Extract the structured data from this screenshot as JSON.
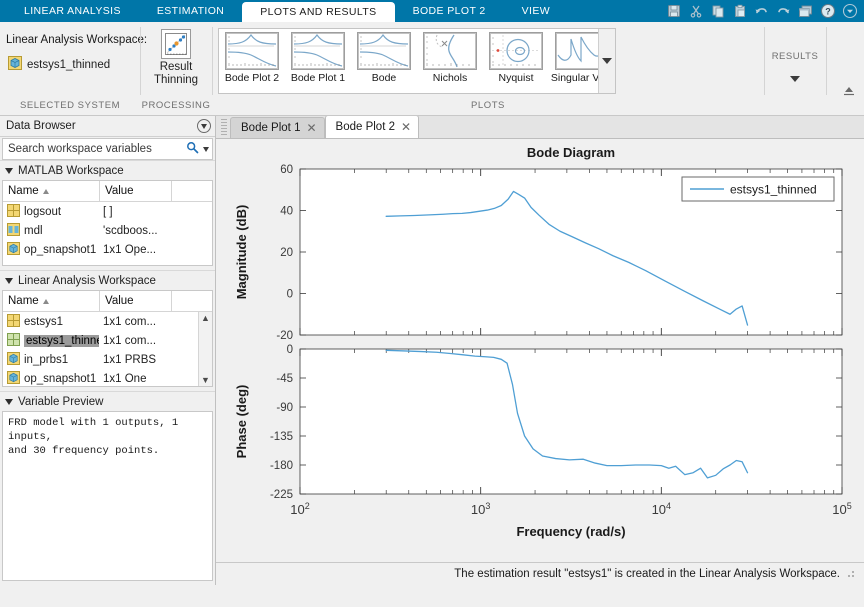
{
  "ribbon": {
    "tabs": [
      {
        "label": "LINEAR ANALYSIS",
        "active": false
      },
      {
        "label": "ESTIMATION",
        "active": false
      },
      {
        "label": "PLOTS AND RESULTS",
        "active": true
      },
      {
        "label": "BODE PLOT 2",
        "active": false
      },
      {
        "label": "VIEW",
        "active": false
      }
    ],
    "quick_access": [
      "save-icon",
      "cut-icon",
      "copy-icon",
      "paste-icon",
      "undo-icon",
      "redo-icon",
      "layout-icon",
      "help-icon",
      "options-icon"
    ],
    "groups": {
      "selected_system": {
        "label": "SELECTED SYSTEM",
        "title": "Linear Analysis Workspace:",
        "variable": "estsys1_thinned"
      },
      "processing": {
        "label": "PROCESSING",
        "button_line1": "Result",
        "button_line2": "Thinning"
      },
      "plots": {
        "label": "PLOTS",
        "items": [
          {
            "label": "Bode Plot 2",
            "icon": "bode-thumbnail"
          },
          {
            "label": "Bode Plot 1",
            "icon": "bode-thumbnail"
          },
          {
            "label": "Bode",
            "icon": "bode-thumbnail"
          },
          {
            "label": "Nichols",
            "icon": "nichols-thumbnail"
          },
          {
            "label": "Nyquist",
            "icon": "nyquist-thumbnail"
          },
          {
            "label": "Singular Va...",
            "icon": "singular-values-thumbnail"
          }
        ]
      },
      "results": {
        "label": "RESULTS"
      }
    }
  },
  "browser": {
    "title": "Data Browser",
    "search": {
      "value": "",
      "placeholder": "Search workspace variables"
    },
    "matlab_workspace": {
      "title": "MATLAB Workspace",
      "columns": [
        "Name",
        "Value"
      ],
      "rows": [
        {
          "icon": "grid-variable-icon",
          "name": "logsout",
          "value": "[ ]",
          "selected": false
        },
        {
          "icon": "string-variable-icon",
          "name": "mdl",
          "value": "'scdboos...",
          "selected": false
        },
        {
          "icon": "object-variable-icon",
          "name": "op_snapshot1",
          "value": "1x1 Ope...",
          "selected": false
        }
      ]
    },
    "linear_analysis_workspace": {
      "title": "Linear Analysis Workspace",
      "columns": [
        "Name",
        "Value"
      ],
      "rows": [
        {
          "icon": "grid-variable-icon",
          "name": "estsys1",
          "value": "1x1 com...",
          "selected": false
        },
        {
          "icon": "grid-variable-icon",
          "name": "estsys1_thinned",
          "value": "1x1 com...",
          "selected": true
        },
        {
          "icon": "object-variable-icon",
          "name": "in_prbs1",
          "value": "1x1 PRBS",
          "selected": false
        },
        {
          "icon": "object-variable-icon",
          "name": "op_snapshot1",
          "value": "1x1 One",
          "selected": false
        }
      ]
    },
    "variable_preview": {
      "title": "Variable Preview",
      "line1": "FRD model with 1 outputs, 1 inputs,",
      "line2": "and 30 frequency points."
    }
  },
  "document": {
    "tabs": [
      {
        "label": "Bode Plot 1",
        "active": false,
        "closable": true
      },
      {
        "label": "Bode Plot 2",
        "active": true,
        "closable": true
      }
    ]
  },
  "status": {
    "message": "The estimation result \"estsys1\" is created in the Linear Analysis Workspace."
  },
  "colors": {
    "ribbon_blue": "#0076a8",
    "line": "#4f9fd4",
    "panel": "#f0f0f0",
    "selection_gray": "#9b9b9b"
  },
  "chart_data": {
    "type": "line",
    "title": "Bode Diagram",
    "xlabel": "Frequency  (rad/s)",
    "xscale": "log",
    "xlim": [
      100,
      100000
    ],
    "xticks": [
      100,
      1000,
      10000,
      100000
    ],
    "xticklabels": [
      "10^2",
      "10^3",
      "10^4",
      "10^5"
    ],
    "legend": [
      "estsys1_thinned"
    ],
    "legend_position": "top-right",
    "grid": false,
    "subplots": [
      {
        "name": "magnitude",
        "ylabel": "Magnitude (dB)",
        "ylim": [
          -20,
          60
        ],
        "yticks": [
          -20,
          0,
          20,
          40,
          60
        ],
        "series": [
          {
            "name": "estsys1_thinned",
            "x": [
              300,
              360,
              430,
              520,
              620,
              700,
              790,
              880,
              980,
              1090,
              1190,
              1300,
              1420,
              1520,
              1620,
              1750,
              1900,
              2100,
              2400,
              2750,
              3200,
              3800,
              4500,
              5400,
              6600,
              8200,
              10500,
              13500,
              17000,
              21000,
              24000,
              26000,
              28000,
              30000
            ],
            "y": [
              37.2,
              37.4,
              37.6,
              37.9,
              38.2,
              38.5,
              38.6,
              39.0,
              39.6,
              40.2,
              41.0,
              42.4,
              45.5,
              49.2,
              47.8,
              46.0,
              41.5,
              37.8,
              33.2,
              30.0,
              27.4,
              24.4,
              21.6,
              18.2,
              15.0,
              11.0,
              6.0,
              1.0,
              -3.5,
              -7.5,
              -10.0,
              -7.5,
              -6.0,
              -15.2
            ]
          }
        ]
      },
      {
        "name": "phase",
        "ylabel": "Phase (deg)",
        "ylim": [
          -225,
          0
        ],
        "yticks": [
          -225,
          -180,
          -135,
          -90,
          -45,
          0
        ],
        "series": [
          {
            "name": "estsys1_thinned",
            "x": [
              300,
              380,
              470,
              570,
              680,
              800,
              930,
              1060,
              1180,
              1300,
              1400,
              1500,
              1600,
              1750,
              1950,
              2200,
              2600,
              3100,
              3700,
              4300,
              5000,
              6000,
              7200,
              8600,
              10000,
              11000,
              12000,
              13500,
              15000,
              16500,
              18000,
              20000,
              22000,
              24000,
              26000,
              28000,
              30000
            ],
            "y": [
              -2,
              -3,
              -4,
              -5,
              -7,
              -9,
              -11,
              -12,
              -13,
              -16,
              -22,
              -55,
              -100,
              -135,
              -155,
              -166,
              -170,
              -172,
              -171,
              -177,
              -181,
              -181,
              -180,
              -180,
              -181,
              -185,
              -182,
              -195,
              -192,
              -185,
              -200,
              -196,
              -186,
              -180,
              -173,
              -175,
              -192
            ]
          }
        ]
      }
    ]
  }
}
